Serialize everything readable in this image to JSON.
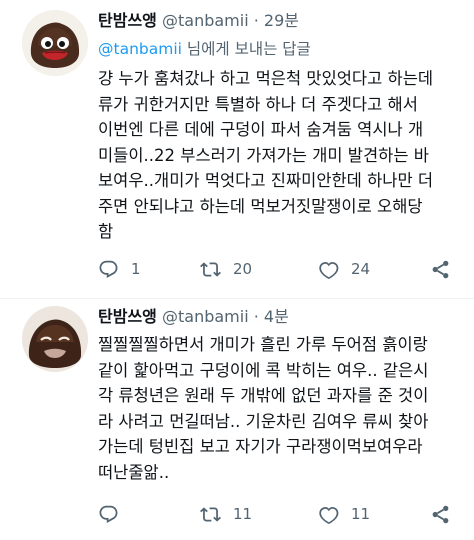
{
  "tweets": [
    {
      "name": "탄밤쓰앵",
      "handle": "@tanbamii",
      "dot": "·",
      "time": "29분",
      "reply_to_mention": "@tanbamii",
      "reply_to_suffix": " 님에게 보내는 답글",
      "text": "걍 누가 훔쳐갔나 하고 먹은척 맛있엇다고 하는데\n류가 귀한거지만 특별하 하나 더 주겟다고 해서\n이번엔 다른 데에 구덩이 파서 숨겨둠 역시나 개\n미들이..22 부스러기 가져가는 개미 발견하는 바\n보여우..개미가 먹엇다고 진짜미안한데 하나만 더\n주면 안되냐고 하는데 먹보거짓말쟁이로 오해당\n함",
      "replies": "1",
      "retweets": "20",
      "likes": "24"
    },
    {
      "name": "탄밤쓰앵",
      "handle": "@tanbamii",
      "dot": "·",
      "time": "4분",
      "text": "찔찔찔찔하면서 개미가 흘린 가루 두어점 흙이랑\n같이 핥아먹고 구덩이에 콕 박히는 여우.. 같은시\n각 류청년은 원래 두 개밖에 없던 과자를 준 것이\n라 사려고 먼길떠남.. 기운차린 김여우 류씨 찾아\n가는데 텅빈집 보고 자기가 구라쟁이먹보여우라\n떠난줄앎..",
      "replies": "",
      "retweets": "11",
      "likes": "11"
    }
  ],
  "icons": {
    "reply": "reply-icon",
    "retweet": "retweet-icon",
    "like": "like-icon",
    "share": "share-icon"
  },
  "colors": {
    "text": "#0f1419",
    "secondary": "#536471",
    "link": "#1d9bf0",
    "divider": "#eff3f4"
  }
}
